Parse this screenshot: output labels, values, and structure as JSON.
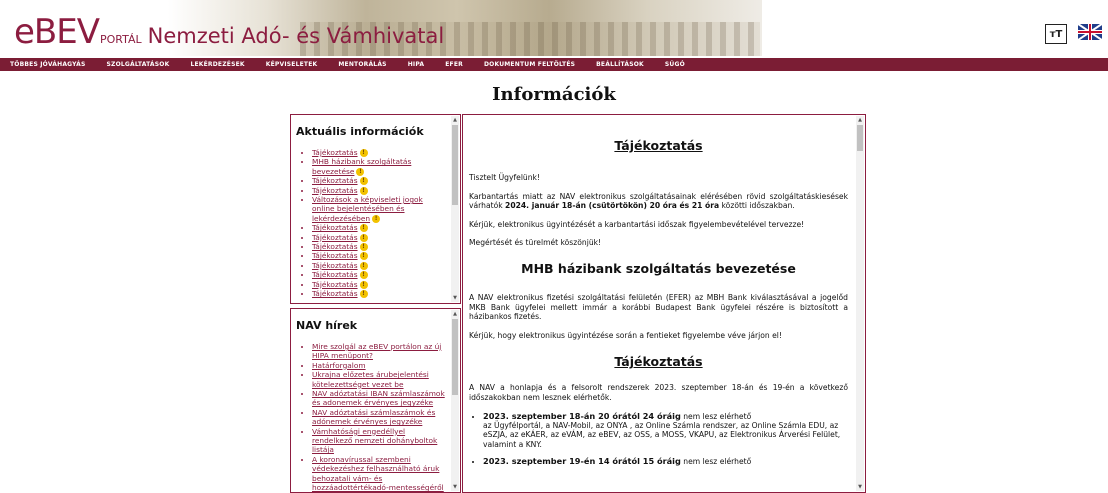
{
  "header": {
    "logo_e": "e",
    "logo_bev": "BEV",
    "logo_portal": "PORTÁL",
    "agency": "Nemzeti Adó- és Vámhivatal",
    "font_button": "тT",
    "language_flag": "uk-flag-icon"
  },
  "nav": {
    "items": [
      "TÖBBES JÓVÁHAGYÁS",
      "SZOLGÁLTATÁSOK",
      "LEKÉRDEZÉSEK",
      "KÉPVISELETEK",
      "MENTORÁLÁS",
      "HIPA",
      "EFER",
      "DOKUMENTUM FELTÖLTÉS",
      "BEÁLLÍTÁSOK",
      "SÚGÓ"
    ]
  },
  "page": {
    "title": "Információk"
  },
  "aktualis": {
    "heading": "Aktuális információk",
    "items": [
      {
        "label": "Tájékoztatás",
        "warn": true
      },
      {
        "label": "MHB házibank szolgáltatás bevezetése",
        "warn": true
      },
      {
        "label": "Tájékoztatás",
        "warn": true
      },
      {
        "label": "Tájékoztatás",
        "warn": true
      },
      {
        "label": "Változások a képviseleti jogok online bejelentésében és lekérdezésében",
        "warn": true
      },
      {
        "label": "Tájékoztatás",
        "warn": true
      },
      {
        "label": "Tájékoztatás",
        "warn": true
      },
      {
        "label": "Tájékoztatás",
        "warn": true
      },
      {
        "label": "Tájékoztatás",
        "warn": true
      },
      {
        "label": "Tájékoztatás",
        "warn": true
      },
      {
        "label": "Tájékoztatás",
        "warn": true
      },
      {
        "label": "Tájékoztatás",
        "warn": true
      },
      {
        "label": "Tájékoztatás",
        "warn": true
      }
    ]
  },
  "hirek": {
    "heading": "NAV hírek",
    "items": [
      "Mire szolgál az eBEV portálon az új HIPA menüpont?",
      "Határforgalom",
      "Ukrajna előzetes árubejelentési kötelezettséget vezet be",
      "NAV adóztatási IBAN számlaszámok és adonemek érvényes jegyzéke",
      "NAV adóztatási számlaszámok és adónemek érvényes jegyzéke",
      "Vámhatósági engedéllyel rendelkező nemzeti dohányboltok listája",
      "A koronavírussal szembeni védekezéshez felhasználható áruk behozatali vám- és hozzáadottértékadó-mentességéről"
    ]
  },
  "content": {
    "s1_title": "Tájékoztatás",
    "s1_p1": "Tisztelt Ügyfelünk!",
    "s1_p2_pre": "Karbantartás miatt az NAV elektronikus szolgáltatásainak elérésében rövid szolgáltatáskiesések várhatók ",
    "s1_p2_bold": "2024. január 18-án (csütörtökön) 20 óra és 21 óra",
    "s1_p2_post": " közötti időszakban.",
    "s1_p3": "Kérjük, elektronikus ügyintézését a karbantartási időszak figyelembevételével tervezze!",
    "s1_p4": "Megértését és türelmét köszönjük!",
    "s2_title": "MHB házibank szolgáltatás bevezetése",
    "s2_p1": "A NAV elektronikus fizetési szolgáltatási felületén (EFER) az MBH Bank kiválasztásával a jogelőd MKB Bank ügyfelei mellett immár a korábbi Budapest Bank ügyfelei részére is biztosított a házibankos fizetés.",
    "s2_p2": "Kérjük, hogy elektronikus ügyintézése során a fentieket figyelembe véve járjon el!",
    "s3_title": "Tájékoztatás",
    "s3_p1": "A NAV a honlapja és a felsorolt rendszerek 2023. szeptember 18-án és 19-én a következő időszakokban nem lesznek elérhetők.",
    "s3_li1_bold": "2023. szeptember 18-án 20 órától 24 óráig",
    "s3_li1_post": " nem lesz elérhető",
    "s3_li1_line2": "az Ügyfélportál, a NAV-Mobil, az ONYA , az Online Számla rendszer, az Online Számla EDU, az eSZJA, az eKÁER, az eVÁM, az eBEV, az OSS, a MOSS, VKAPU, az Elektronikus Árverési Felület, valamint a KNY.",
    "s3_li2_bold": "2023. szeptember 19-én 14 órától 15 óráig",
    "s3_li2_post": " nem lesz elérhető"
  }
}
